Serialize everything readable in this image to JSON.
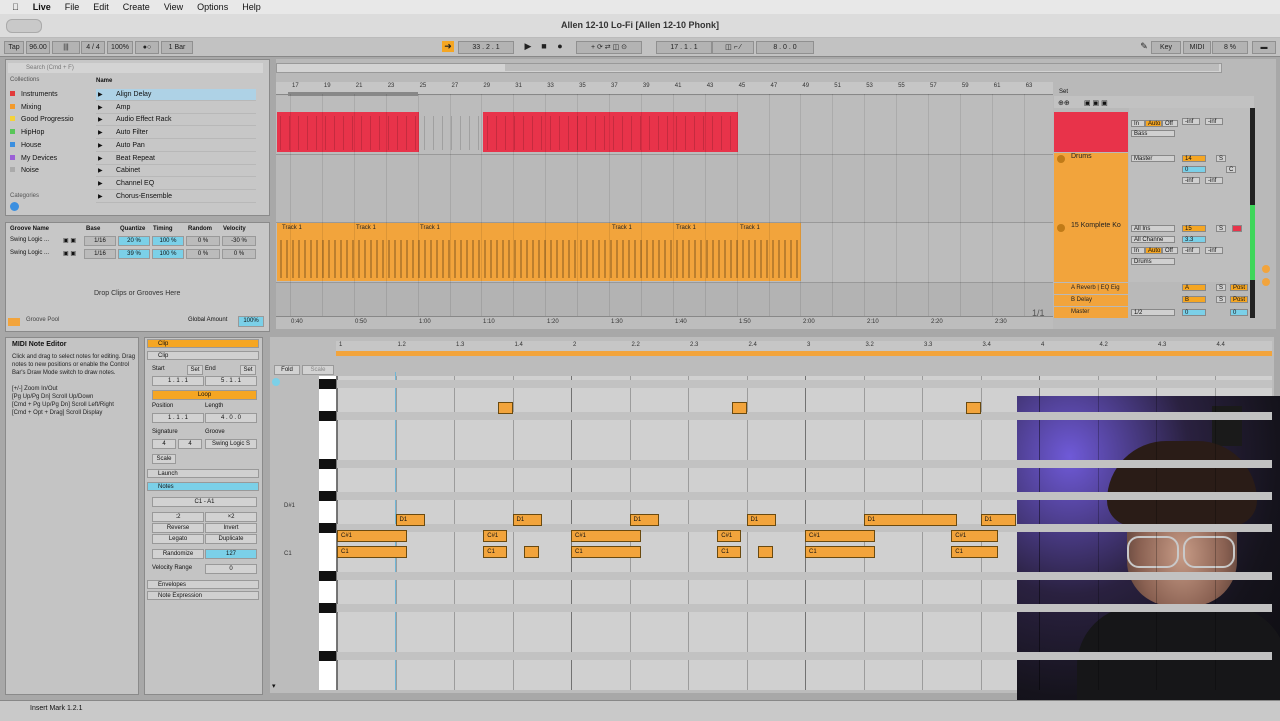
{
  "menubar": {
    "app": "Live",
    "items": [
      "File",
      "Edit",
      "Create",
      "View",
      "Options",
      "Help"
    ]
  },
  "window": {
    "title": "Allen 12-10 Lo-Fi  [Allen 12-10 Phonk]"
  },
  "transport": {
    "tap": "Tap",
    "tempo": "96.00",
    "sig": "4 / 4",
    "zoom": "100%",
    "quant": "1 Bar",
    "position": "33 .  2 .  1",
    "loop_start": "17 .  1 .  1",
    "loop_len": "8 .  0 .  0",
    "key": "Key",
    "midi": "MIDI",
    "cpu": "8 %"
  },
  "browser": {
    "search_placeholder": "Search (Cmd + F)",
    "collections_label": "Collections",
    "collections": [
      {
        "name": "Instruments",
        "color": "#e23b3b"
      },
      {
        "name": "Mixing",
        "color": "#f39a2b"
      },
      {
        "name": "Good Progressio",
        "color": "#f4d23a"
      },
      {
        "name": "HipHop",
        "color": "#58c659"
      },
      {
        "name": "House",
        "color": "#3b8fe0"
      },
      {
        "name": "My Devices",
        "color": "#9a5fd6"
      },
      {
        "name": "Noise",
        "color": "#aaaaaa"
      }
    ],
    "categories_label": "Categories",
    "name_header": "Name",
    "items": [
      "Align Delay",
      "Amp",
      "Audio Effect Rack",
      "Auto Filter",
      "Auto Pan",
      "Beat Repeat",
      "Cabinet",
      "Channel EQ",
      "Chorus-Ensemble"
    ]
  },
  "groove": {
    "headers": [
      "Groove Name",
      "Base",
      "Quantize",
      "Timing",
      "Random",
      "Velocity"
    ],
    "rows": [
      {
        "name": "Swing Logic ...",
        "base": "1/16",
        "quantize": "20 %",
        "timing": "100 %",
        "random": "0 %",
        "velocity": "-30 %"
      },
      {
        "name": "Swing Logic ...",
        "base": "1/16",
        "quantize": "39 %",
        "timing": "100 %",
        "random": "0 %",
        "velocity": "0 %"
      }
    ],
    "drop_hint": "Drop Clips or Grooves Here",
    "pool_label": "Groove Pool",
    "global_label": "Global Amount",
    "global_value": "100%"
  },
  "arrangement": {
    "bar_numbers": [
      "17",
      "19",
      "21",
      "23",
      "25",
      "27",
      "29",
      "31",
      "33",
      "35",
      "37",
      "39",
      "41",
      "43",
      "45",
      "47",
      "49",
      "51",
      "53",
      "55",
      "57",
      "59",
      "61",
      "63"
    ],
    "time_marks": [
      "0:40",
      "0:50",
      "1:00",
      "1:10",
      "1:20",
      "1:30",
      "1:40",
      "1:50",
      "2:00",
      "2:10",
      "2:20",
      "2:30"
    ],
    "clip_label": "Track 1",
    "set_label": "Set",
    "page_indicator": "1/1"
  },
  "tracks": [
    {
      "name": "",
      "routing": "Bass",
      "volume": "",
      "pan": "",
      "color": "#e8334a"
    },
    {
      "name": "Drums",
      "routing": "Master",
      "volume": "14",
      "pan": "C",
      "color": "#f2a43c"
    },
    {
      "name": "15 Komplete Ko",
      "routing": "All Ins",
      "sub": "All Channe",
      "out": "Drums",
      "volume": "15",
      "pan": "3.3",
      "color": "#f2a43c"
    }
  ],
  "returns": [
    {
      "name": "A Reverb | EQ Eig",
      "letter": "A"
    },
    {
      "name": "B Delay",
      "letter": "B"
    },
    {
      "name": "Master",
      "routing": "1/2",
      "vol": "0",
      "pan": "0"
    }
  ],
  "mixer": {
    "in": "In",
    "auto": "Auto",
    "off": "Off",
    "inf": "-inf",
    "solo": "S",
    "post": "Post"
  },
  "info": {
    "title": "MIDI Note Editor",
    "body": "Click and drag to select notes for editing. Drag notes to new positions or enable the Control Bar's Draw Mode switch to draw notes.\n\n[+/-] Zoom In/Out\n[Pg Up/Pg Dn] Scroll Up/Down\n[Cmd + Pg Up/Pg Dn] Scroll Left/Right\n[Cmd + Opt + Drag] Scroll Display"
  },
  "clip_panel": {
    "section_clip": "Clip",
    "clip": "Clip",
    "start_label": "Start",
    "end_label": "End",
    "set": "Set",
    "start": "1 .  1 .  1",
    "end": "5 .  1 .  1",
    "loop": "Loop",
    "position_label": "Position",
    "length_label": "Length",
    "position": "1 .  1 .  1",
    "length": "4 .  0 .  0",
    "signature_label": "Signature",
    "groove_label": "Groove",
    "sig_num": "4",
    "sig_den": "4",
    "groove_value": "Swing Logic S",
    "scale": "Scale",
    "launch": "Launch",
    "notes": "Notes",
    "note_range": "C1 - A1",
    "half": ":2",
    "double": "×2",
    "reverse": "Reverse",
    "invert": "Invert",
    "legato": "Legato",
    "duplicate": "Duplicate",
    "randomize": "Randomize",
    "randomize_value": "127",
    "velocity_range_label": "Velocity Range",
    "velocity_range": "0",
    "envelopes": "Envelopes",
    "note_expression": "Note Expression"
  },
  "piano_roll": {
    "fold": "Fold",
    "scale": "Scale",
    "beat_labels": [
      "1",
      "1.2",
      "1.3",
      "1.4",
      "2",
      "2.2",
      "2.3",
      "2.4",
      "3",
      "3.2",
      "3.3",
      "3.4",
      "4",
      "4.2",
      "4.3",
      "4.4"
    ],
    "pitch_labels": [
      "D#1",
      "C1"
    ],
    "notes": [
      {
        "pitch": "A",
        "start": 2.75,
        "len": 0.25
      },
      {
        "pitch": "A",
        "start": 6.75,
        "len": 0.25
      },
      {
        "pitch": "A",
        "start": 10.75,
        "len": 0.25
      },
      {
        "pitch": "D1",
        "start": 1.0,
        "len": 0.5
      },
      {
        "pitch": "D1",
        "start": 3.0,
        "len": 0.5
      },
      {
        "pitch": "D1",
        "start": 5.0,
        "len": 0.5
      },
      {
        "pitch": "D1",
        "start": 7.0,
        "len": 0.5
      },
      {
        "pitch": "D1",
        "start": 9.0,
        "len": 1.6
      },
      {
        "pitch": "D1",
        "start": 11.0,
        "len": 0.6
      },
      {
        "pitch": "C#1",
        "start": 0.0,
        "len": 1.2
      },
      {
        "pitch": "C#1",
        "start": 2.5,
        "len": 0.4
      },
      {
        "pitch": "C#1",
        "start": 4.0,
        "len": 1.2
      },
      {
        "pitch": "C#1",
        "start": 6.5,
        "len": 0.4
      },
      {
        "pitch": "C#1",
        "start": 8.0,
        "len": 1.2
      },
      {
        "pitch": "C#1",
        "start": 10.5,
        "len": 0.8
      },
      {
        "pitch": "C1",
        "start": 0.0,
        "len": 1.2
      },
      {
        "pitch": "C1",
        "start": 2.5,
        "len": 0.4
      },
      {
        "pitch": "C1",
        "start": 3.2,
        "len": 0.25
      },
      {
        "pitch": "C1",
        "start": 4.0,
        "len": 1.2
      },
      {
        "pitch": "C1",
        "start": 6.5,
        "len": 0.4
      },
      {
        "pitch": "C1",
        "start": 7.2,
        "len": 0.25
      },
      {
        "pitch": "C1",
        "start": 8.0,
        "len": 1.2
      },
      {
        "pitch": "C1",
        "start": 10.5,
        "len": 0.8
      }
    ]
  },
  "status": {
    "text": "Insert Mark 1.2.1"
  }
}
